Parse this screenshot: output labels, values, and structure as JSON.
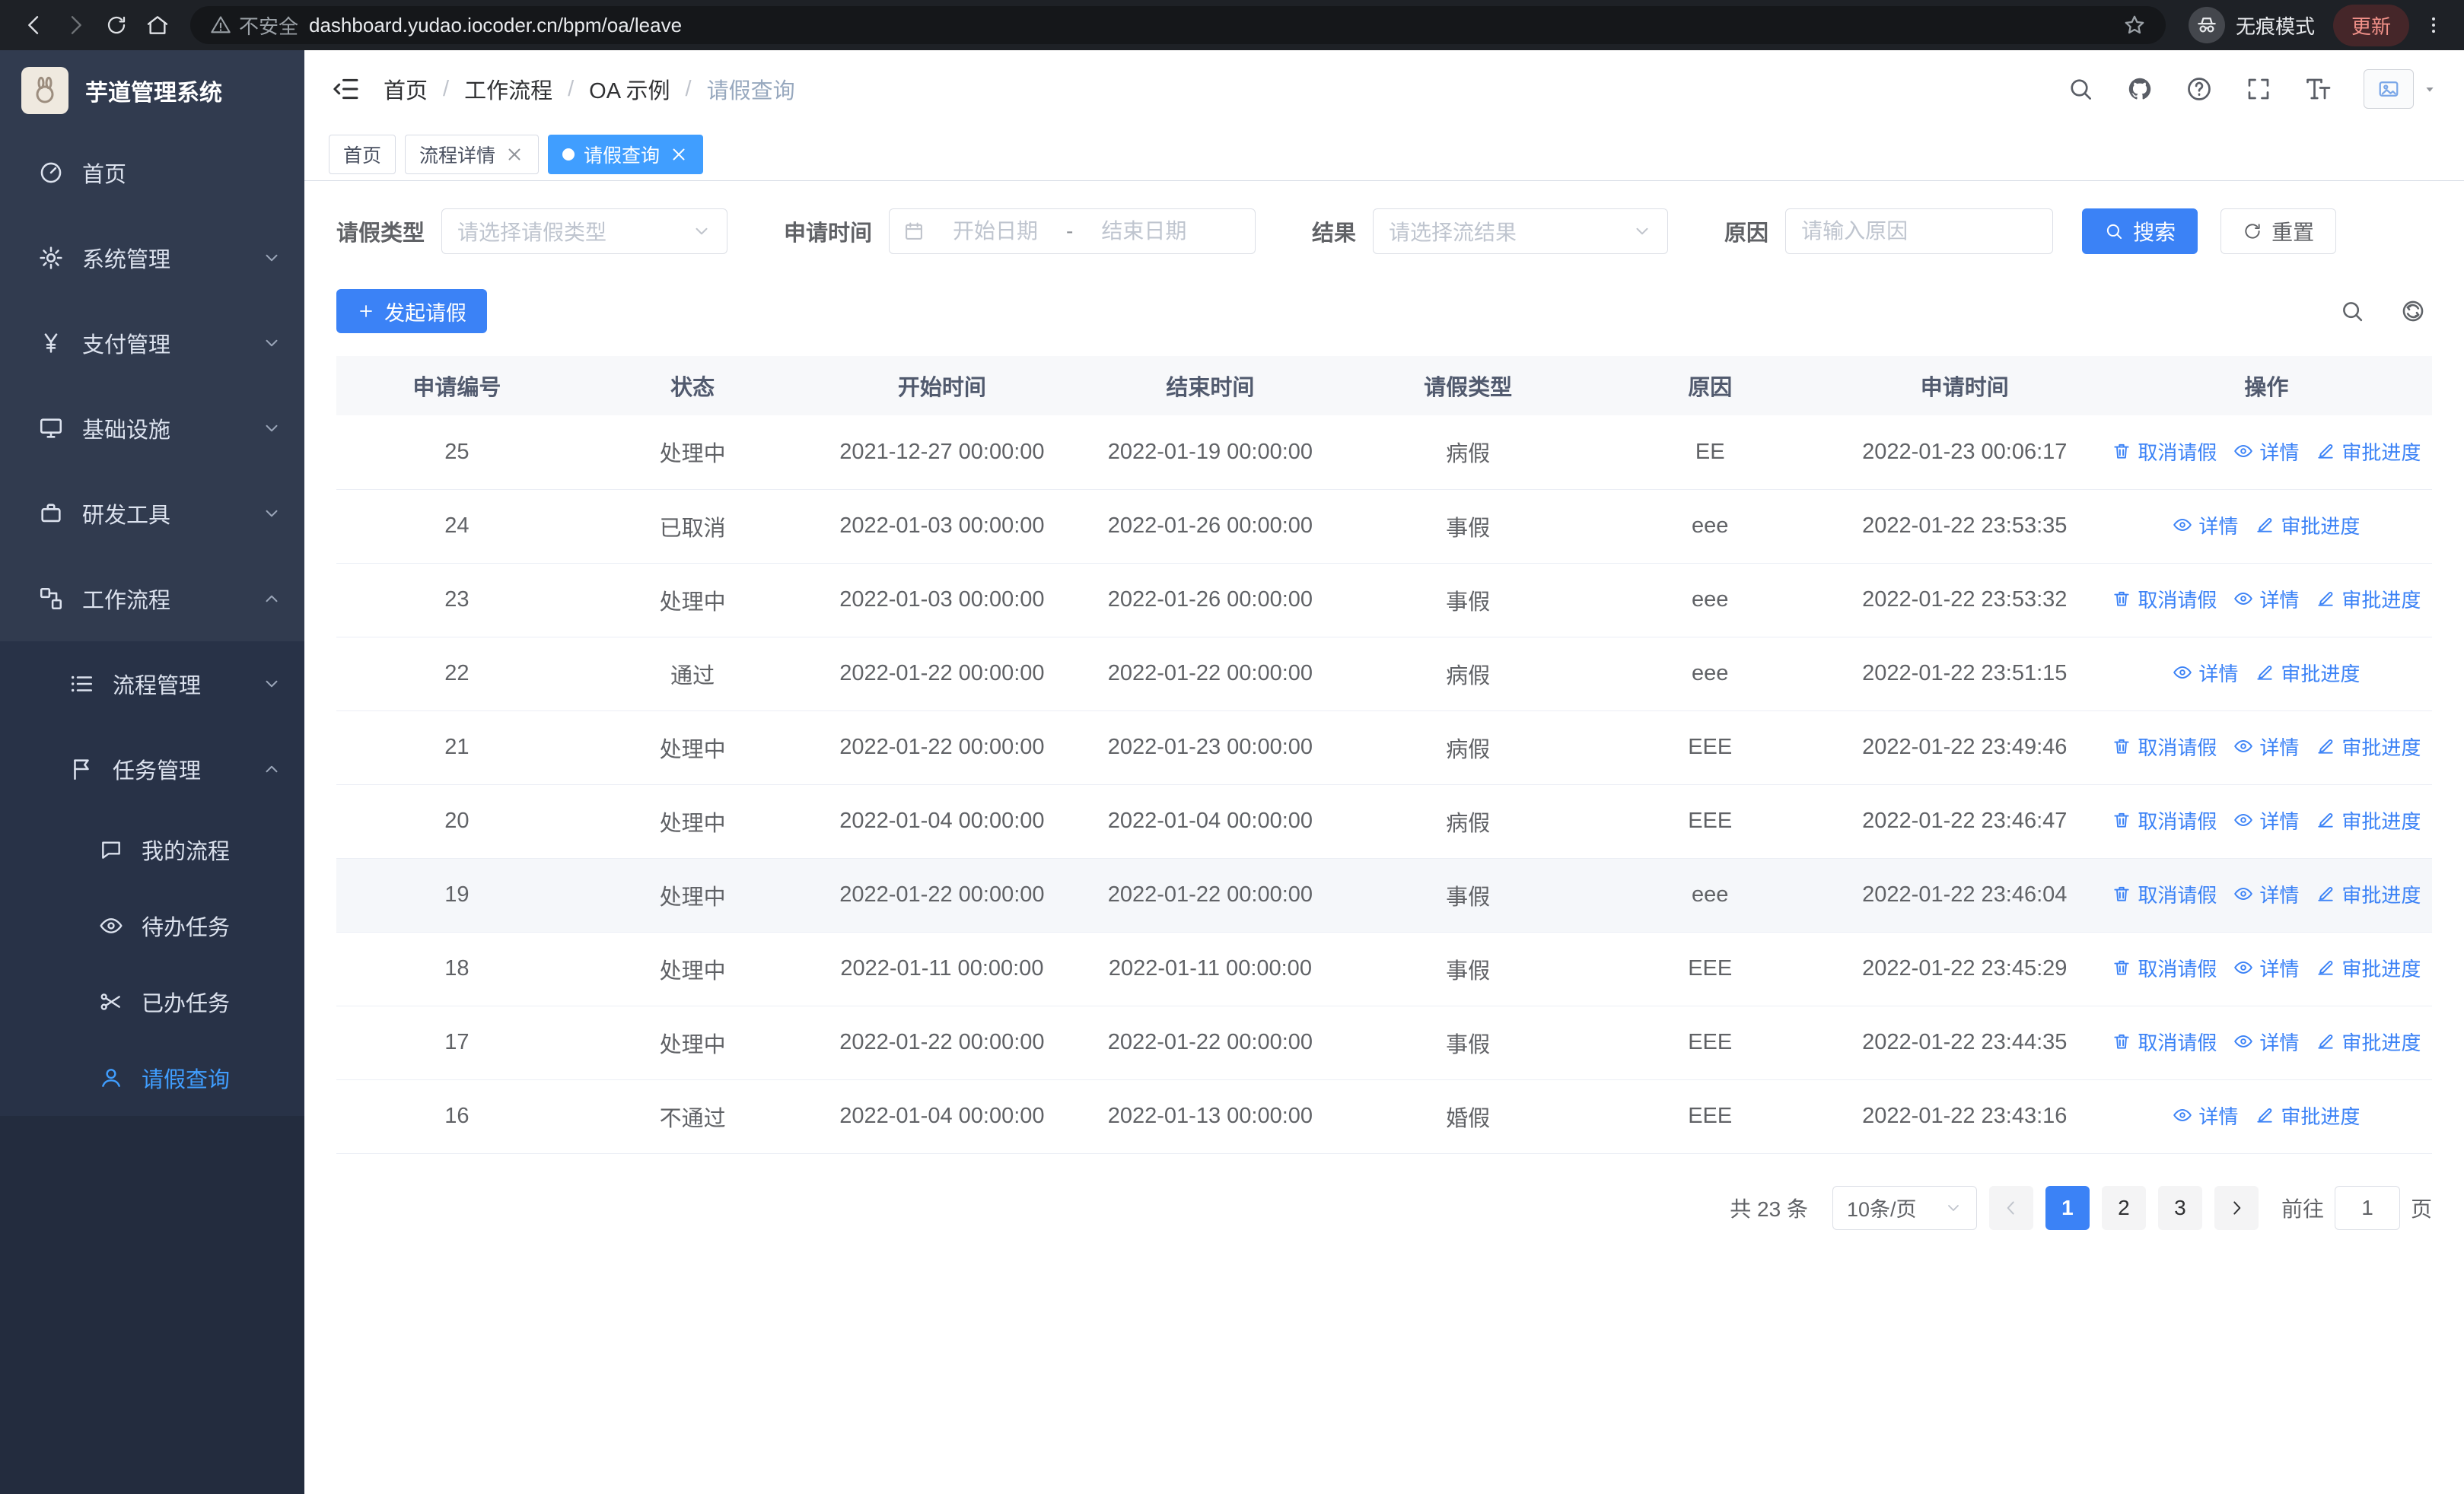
{
  "theme": {
    "primary": "#3b82f6",
    "tab_active": "#409eff",
    "sidebar_bg": "#313b4f",
    "sidebar_submenu_bg": "#283247",
    "sidebar_filler_bg": "#232c3e",
    "browser_bar_bg": "#1e2126",
    "table_header_bg": "#f7f8fa"
  },
  "browser": {
    "security_label": "不安全",
    "url": "dashboard.yudao.iocoder.cn/bpm/oa/leave",
    "incognito_label": "无痕模式",
    "update_label": "更新"
  },
  "sidebar": {
    "title": "芋道管理系统",
    "items": [
      {
        "label": "首页",
        "icon": "dashboard"
      },
      {
        "label": "系统管理",
        "icon": "gear"
      },
      {
        "label": "支付管理",
        "icon": "yen"
      },
      {
        "label": "基础设施",
        "icon": "infra"
      },
      {
        "label": "研发工具",
        "icon": "tools"
      },
      {
        "label": "工作流程",
        "icon": "workflow"
      }
    ],
    "submenu": {
      "process_mgmt": {
        "label": "流程管理",
        "icon": "process"
      },
      "task_mgmt": {
        "label": "任务管理",
        "icon": "task"
      },
      "children": [
        {
          "label": "我的流程",
          "icon": "chat"
        },
        {
          "label": "待办任务",
          "icon": "eye"
        },
        {
          "label": "已办任务",
          "icon": "scissors"
        },
        {
          "label": "请假查询",
          "icon": "user",
          "active": true
        }
      ]
    }
  },
  "header": {
    "breadcrumb": [
      "首页",
      "工作流程",
      "OA 示例",
      "请假查询"
    ]
  },
  "tabs": [
    {
      "label": "首页",
      "closable": false,
      "active": false
    },
    {
      "label": "流程详情",
      "closable": true,
      "active": false
    },
    {
      "label": "请假查询",
      "closable": true,
      "active": true
    }
  ],
  "filters": {
    "leave_type_label": "请假类型",
    "leave_type_placeholder": "请选择请假类型",
    "time_label": "申请时间",
    "start_placeholder": "开始日期",
    "range_separator": "-",
    "end_placeholder": "结束日期",
    "result_label": "结果",
    "result_placeholder": "请选择流结果",
    "reason_label": "原因",
    "reason_placeholder": "请输入原因",
    "search_label": "搜索",
    "reset_label": "重置"
  },
  "toolbar": {
    "create_label": "发起请假"
  },
  "table": {
    "columns": [
      "申请编号",
      "状态",
      "开始时间",
      "结束时间",
      "请假类型",
      "原因",
      "申请时间",
      "操作"
    ],
    "rows": [
      {
        "no": "25",
        "status": "处理中",
        "start": "2021-12-27 00:00:00",
        "end": "2022-01-19 00:00:00",
        "type": "病假",
        "reason": "EE",
        "applied": "2022-01-23 00:06:17",
        "actions": [
          {
            "label": "取消请假",
            "icon": "trash"
          },
          {
            "label": "详情",
            "icon": "eye"
          },
          {
            "label": "审批进度",
            "icon": "edit"
          }
        ]
      },
      {
        "no": "24",
        "status": "已取消",
        "start": "2022-01-03 00:00:00",
        "end": "2022-01-26 00:00:00",
        "type": "事假",
        "reason": "eee",
        "applied": "2022-01-22 23:53:35",
        "actions": [
          {
            "label": "详情",
            "icon": "eye"
          },
          {
            "label": "审批进度",
            "icon": "edit"
          }
        ]
      },
      {
        "no": "23",
        "status": "处理中",
        "start": "2022-01-03 00:00:00",
        "end": "2022-01-26 00:00:00",
        "type": "事假",
        "reason": "eee",
        "applied": "2022-01-22 23:53:32",
        "actions": [
          {
            "label": "取消请假",
            "icon": "trash"
          },
          {
            "label": "详情",
            "icon": "eye"
          },
          {
            "label": "审批进度",
            "icon": "edit"
          }
        ]
      },
      {
        "no": "22",
        "status": "通过",
        "start": "2022-01-22 00:00:00",
        "end": "2022-01-22 00:00:00",
        "type": "病假",
        "reason": "eee",
        "applied": "2022-01-22 23:51:15",
        "actions": [
          {
            "label": "详情",
            "icon": "eye"
          },
          {
            "label": "审批进度",
            "icon": "edit"
          }
        ]
      },
      {
        "no": "21",
        "status": "处理中",
        "start": "2022-01-22 00:00:00",
        "end": "2022-01-23 00:00:00",
        "type": "病假",
        "reason": "EEE",
        "applied": "2022-01-22 23:49:46",
        "actions": [
          {
            "label": "取消请假",
            "icon": "trash"
          },
          {
            "label": "详情",
            "icon": "eye"
          },
          {
            "label": "审批进度",
            "icon": "edit"
          }
        ]
      },
      {
        "no": "20",
        "status": "处理中",
        "start": "2022-01-04 00:00:00",
        "end": "2022-01-04 00:00:00",
        "type": "病假",
        "reason": "EEE",
        "applied": "2022-01-22 23:46:47",
        "actions": [
          {
            "label": "取消请假",
            "icon": "trash"
          },
          {
            "label": "详情",
            "icon": "eye"
          },
          {
            "label": "审批进度",
            "icon": "edit"
          }
        ]
      },
      {
        "no": "19",
        "status": "处理中",
        "start": "2022-01-22 00:00:00",
        "end": "2022-01-22 00:00:00",
        "type": "事假",
        "reason": "eee",
        "applied": "2022-01-22 23:46:04",
        "hovered": true,
        "actions": [
          {
            "label": "取消请假",
            "icon": "trash"
          },
          {
            "label": "详情",
            "icon": "eye"
          },
          {
            "label": "审批进度",
            "icon": "edit"
          }
        ]
      },
      {
        "no": "18",
        "status": "处理中",
        "start": "2022-01-11 00:00:00",
        "end": "2022-01-11 00:00:00",
        "type": "事假",
        "reason": "EEE",
        "applied": "2022-01-22 23:45:29",
        "actions": [
          {
            "label": "取消请假",
            "icon": "trash"
          },
          {
            "label": "详情",
            "icon": "eye"
          },
          {
            "label": "审批进度",
            "icon": "edit"
          }
        ]
      },
      {
        "no": "17",
        "status": "处理中",
        "start": "2022-01-22 00:00:00",
        "end": "2022-01-22 00:00:00",
        "type": "事假",
        "reason": "EEE",
        "applied": "2022-01-22 23:44:35",
        "actions": [
          {
            "label": "取消请假",
            "icon": "trash"
          },
          {
            "label": "详情",
            "icon": "eye"
          },
          {
            "label": "审批进度",
            "icon": "edit"
          }
        ]
      },
      {
        "no": "16",
        "status": "不通过",
        "start": "2022-01-04 00:00:00",
        "end": "2022-01-13 00:00:00",
        "type": "婚假",
        "reason": "EEE",
        "applied": "2022-01-22 23:43:16",
        "actions": [
          {
            "label": "详情",
            "icon": "eye"
          },
          {
            "label": "审批进度",
            "icon": "edit"
          }
        ]
      }
    ]
  },
  "pagination": {
    "total": "共 23 条",
    "page_size": "10条/页",
    "pages": [
      "1",
      "2",
      "3"
    ],
    "current_page": "1",
    "goto_label": "前往",
    "goto_value": "1",
    "goto_unit": "页"
  }
}
